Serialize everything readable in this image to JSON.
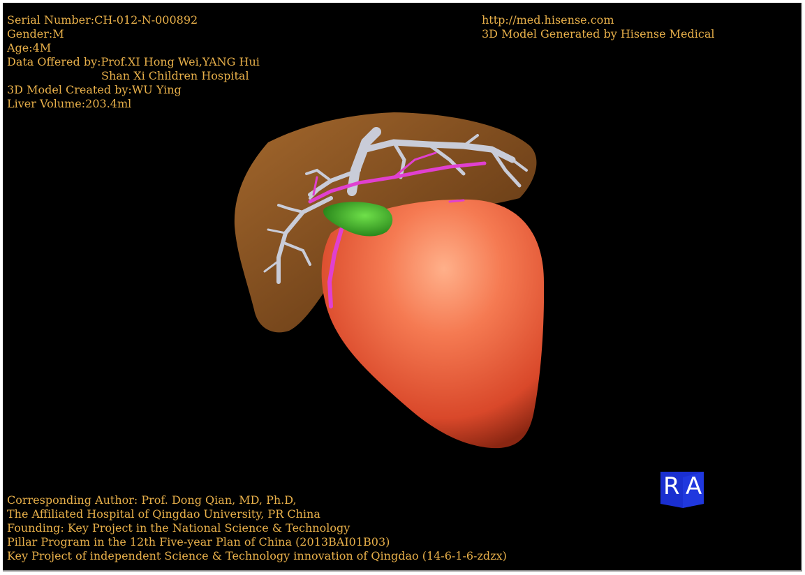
{
  "info": {
    "serial": "Serial Number:CH-012-N-000892",
    "gender": "Gender:M",
    "age": "Age:4M",
    "data_offered": "Data Offered by:Prof.XI Hong Wei,YANG Hui",
    "hospital": "Shan Xi Children Hospital",
    "created_by": "3D Model Created by:WU Ying",
    "liver_volume": "Liver Volume:203.4ml"
  },
  "credit": {
    "url": "http://med.hisense.com",
    "generated_by": "3D Model Generated by Hisense Medical"
  },
  "footer": {
    "line1": "Corresponding Author: Prof. Dong Qian, MD, Ph.D,",
    "line2": "The Affiliated Hospital of Qingdao University, PR China",
    "line3": "Founding: Key Project in the National Science & Technology",
    "line4": "Pillar Program in the 12th Five-year Plan of China (2013BAI01B03)",
    "line5": "Key Project of independent Science & Technology innovation of Qingdao (14-6-1-6-zdzx)"
  },
  "orientation": {
    "right": "R",
    "anterior": "A"
  },
  "colors": {
    "text": "#e8b04a",
    "background": "#000000",
    "mass": "#f06a45",
    "liver": "#a0622a",
    "portal_vein": "#c9ccd8",
    "artery": "#e040d0",
    "gallbladder": "#3fbf2a",
    "cube": "#1a2fd0"
  }
}
